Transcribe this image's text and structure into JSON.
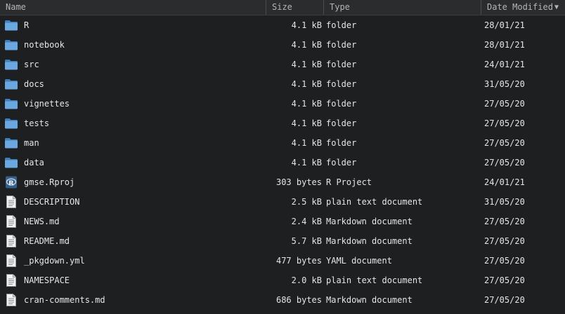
{
  "header": {
    "name": "Name",
    "size": "Size",
    "type": "Type",
    "date": "Date Modified",
    "sort_arrow": "▼"
  },
  "files": [
    {
      "name": "R",
      "size": "4.1 kB",
      "type": "folder",
      "date": "28/01/21",
      "icon": "folder-icon"
    },
    {
      "name": "notebook",
      "size": "4.1 kB",
      "type": "folder",
      "date": "28/01/21",
      "icon": "folder-icon"
    },
    {
      "name": "src",
      "size": "4.1 kB",
      "type": "folder",
      "date": "24/01/21",
      "icon": "folder-icon"
    },
    {
      "name": "docs",
      "size": "4.1 kB",
      "type": "folder",
      "date": "31/05/20",
      "icon": "folder-icon"
    },
    {
      "name": "vignettes",
      "size": "4.1 kB",
      "type": "folder",
      "date": "27/05/20",
      "icon": "folder-icon"
    },
    {
      "name": "tests",
      "size": "4.1 kB",
      "type": "folder",
      "date": "27/05/20",
      "icon": "folder-icon"
    },
    {
      "name": "man",
      "size": "4.1 kB",
      "type": "folder",
      "date": "27/05/20",
      "icon": "folder-icon"
    },
    {
      "name": "data",
      "size": "4.1 kB",
      "type": "folder",
      "date": "27/05/20",
      "icon": "folder-icon"
    },
    {
      "name": "gmse.Rproj",
      "size": "303 bytes",
      "type": "R Project",
      "date": "24/01/21",
      "icon": "r-project-icon"
    },
    {
      "name": "DESCRIPTION",
      "size": "2.5 kB",
      "type": "plain text document",
      "date": "31/05/20",
      "icon": "text-file-icon"
    },
    {
      "name": "NEWS.md",
      "size": "2.4 kB",
      "type": "Markdown document",
      "date": "27/05/20",
      "icon": "text-file-icon"
    },
    {
      "name": "README.md",
      "size": "5.7 kB",
      "type": "Markdown document",
      "date": "27/05/20",
      "icon": "text-file-icon"
    },
    {
      "name": "_pkgdown.yml",
      "size": "477 bytes",
      "type": "YAML document",
      "date": "27/05/20",
      "icon": "text-file-icon"
    },
    {
      "name": "NAMESPACE",
      "size": "2.0 kB",
      "type": "plain text document",
      "date": "27/05/20",
      "icon": "text-file-icon"
    },
    {
      "name": "cran-comments.md",
      "size": "686 bytes",
      "type": "Markdown document",
      "date": "27/05/20",
      "icon": "text-file-icon"
    }
  ],
  "colors": {
    "background": "#1d1f21",
    "header_background": "#2a2c2e",
    "folder_blue": "#5f9ed6",
    "text": "#e6e6e6"
  }
}
